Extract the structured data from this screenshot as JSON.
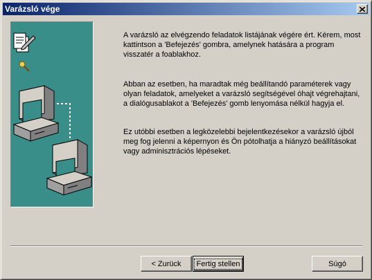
{
  "window": {
    "title": "Varázsló vége"
  },
  "content": {
    "paragraphs": [
      "A varázsló az elvégzendo feladatok listájának végére ért. Kérem, most kattintson a 'Befejezés' gombra, amelynek hatására a program visszatér a foablakhoz.",
      "Abban az esetben, ha maradtak még beállítandó paraméterek vagy olyan  feladatok, amelyeket a varázsló segítségével óhajt  végrehajtani, a dialógusablakot a 'Befejezés' gomb lenyomása  nélkül hagyja el.",
      "Ez utóbbi esetben a legközelebbi bejelentkezésekor a varázsló újból meg fog jelenni a képernyon és Ön pótolhatja  a hiányzó beállításokat vagy adminisztrációs lépéseket."
    ]
  },
  "buttons": {
    "back_label": "< Zurück",
    "finish_label": "Fertig stellen",
    "help_label": "Súgó"
  },
  "colors": {
    "side_panel": "#3a8e8a",
    "titlebar_start": "#0a246a",
    "titlebar_end": "#a6caf0"
  }
}
